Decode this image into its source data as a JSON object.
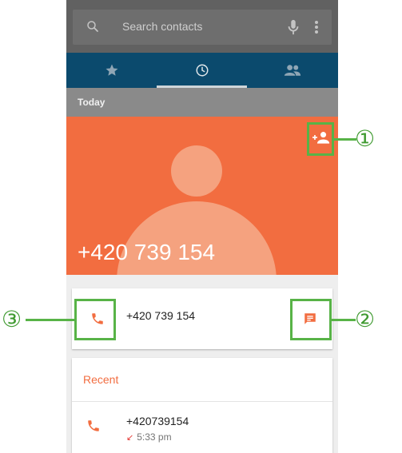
{
  "search": {
    "placeholder": "Search contacts"
  },
  "icons": {
    "search": "search-icon",
    "mic": "microphone-icon",
    "menu": "more-vert-icon",
    "tab_favorites": "star-icon",
    "tab_recents": "clock-icon",
    "tab_contacts": "people-icon",
    "add_contact": "add-person-icon",
    "call": "phone-icon",
    "message": "message-icon"
  },
  "tabs": {
    "selected": "recents"
  },
  "section": {
    "today": "Today"
  },
  "contact": {
    "number": "+420 739 154"
  },
  "actions": {
    "number": "+420 739 154"
  },
  "recent": {
    "header": "Recent",
    "items": [
      {
        "number": "+420739154",
        "time": "5:33 pm"
      }
    ]
  },
  "callouts": {
    "one": "①",
    "two": "②",
    "three": "③"
  },
  "colors": {
    "accent": "#f26d40",
    "tab_bar": "#0b4a6d",
    "highlight": "#58b347",
    "missed_arrow": "#e53935"
  }
}
